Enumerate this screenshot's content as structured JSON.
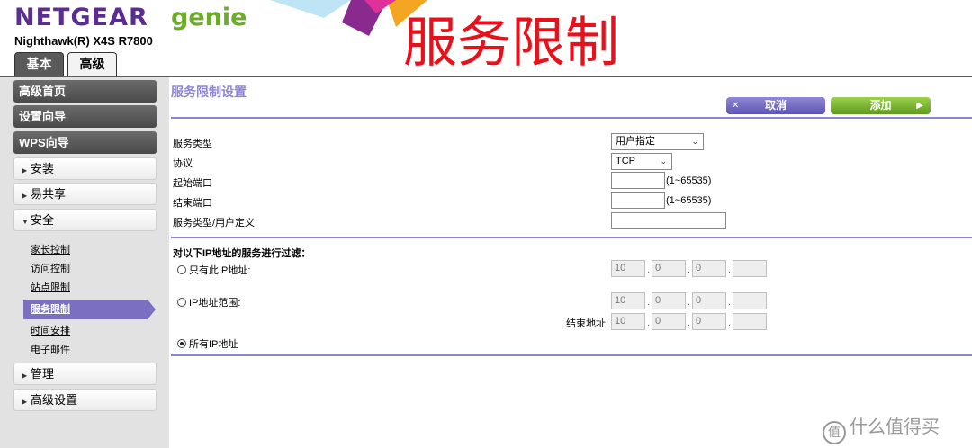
{
  "header": {
    "brand": "NETGEAR",
    "genie": "genie",
    "model": "Nighthawk(R) X4S R7800",
    "overlay_title": "服务限制",
    "tabs": [
      {
        "label": "基本"
      },
      {
        "label": "高级"
      }
    ]
  },
  "sidebar": {
    "buttons": [
      {
        "label": "高级首页"
      },
      {
        "label": "设置向导"
      },
      {
        "label": "WPS向导"
      }
    ],
    "groups": [
      {
        "label": "安装"
      },
      {
        "label": "易共享"
      },
      {
        "label": "安全"
      },
      {
        "label": "管理"
      },
      {
        "label": "高级设置"
      }
    ],
    "security_items": [
      {
        "label": "家长控制"
      },
      {
        "label": "访问控制"
      },
      {
        "label": "站点限制"
      },
      {
        "label": "服务限制"
      },
      {
        "label": "时间安排"
      },
      {
        "label": "电子邮件"
      }
    ]
  },
  "main": {
    "title": "服务限制设置",
    "cancel_label": "取消",
    "add_label": "添加",
    "fields": {
      "service_type_label": "服务类型",
      "service_type_value": "用户指定",
      "protocol_label": "协议",
      "protocol_value": "TCP",
      "start_port_label": "起始端口",
      "start_port_hint": "(1~65535)",
      "end_port_label": "结束端口",
      "end_port_hint": "(1~65535)",
      "service_user_label": "服务类型/用户定义"
    },
    "filter": {
      "heading": "对以下IP地址的服务进行过滤：",
      "only_ip_label": "只有此IP地址:",
      "ip_range_label": "IP地址范围:",
      "end_address_label": "结束地址:",
      "all_ip_label": "所有IP地址",
      "only_ip": [
        "10",
        "0",
        "0",
        ""
      ],
      "range_start": [
        "10",
        "0",
        "0",
        ""
      ],
      "range_end": [
        "10",
        "0",
        "0",
        ""
      ],
      "selected": "all_ip"
    }
  },
  "watermark": "什么值得买"
}
